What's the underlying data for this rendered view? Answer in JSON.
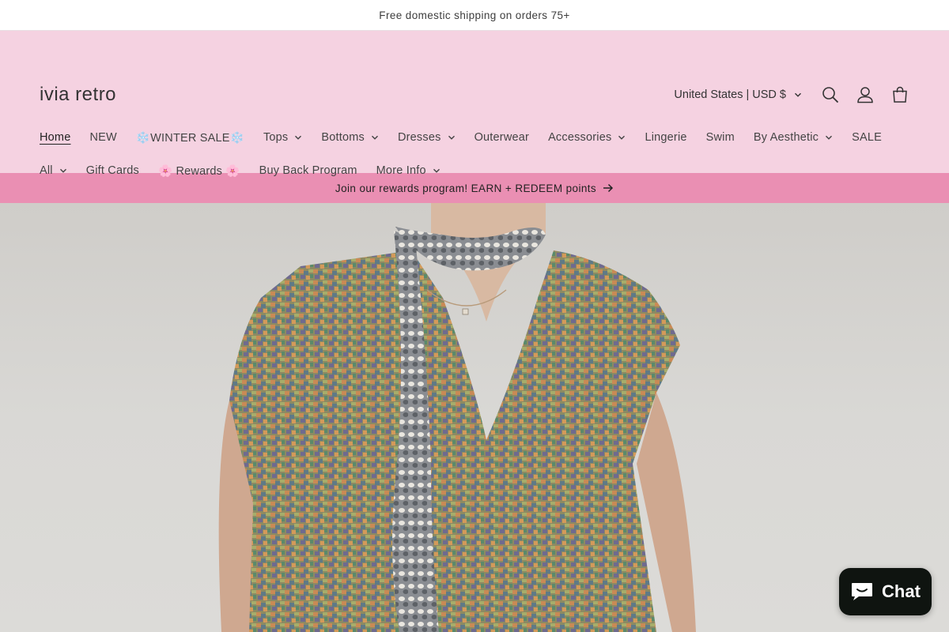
{
  "announcement": {
    "text": "Free domestic shipping on orders 75+"
  },
  "header": {
    "logo": "ivia retro",
    "currency": "United States | USD $",
    "icons": [
      "search-icon",
      "account-icon",
      "cart-icon"
    ]
  },
  "nav": {
    "row1": [
      {
        "label": "Home",
        "active": true,
        "dropdown": false
      },
      {
        "label": "NEW",
        "dropdown": false
      },
      {
        "label": "❄️WINTER SALE❄️",
        "dropdown": false
      },
      {
        "label": "Tops",
        "dropdown": true
      },
      {
        "label": "Bottoms",
        "dropdown": true
      },
      {
        "label": "Dresses",
        "dropdown": true
      },
      {
        "label": "Outerwear",
        "dropdown": false
      },
      {
        "label": "Accessories",
        "dropdown": true
      },
      {
        "label": "Lingerie",
        "dropdown": false
      },
      {
        "label": "Swim",
        "dropdown": false
      },
      {
        "label": "By Aesthetic",
        "dropdown": true
      },
      {
        "label": "SALE",
        "dropdown": false
      },
      {
        "label": "All",
        "dropdown": true
      }
    ],
    "row2": [
      {
        "label": "Gift Cards",
        "dropdown": false
      },
      {
        "label": "🌸 Rewards 🌸",
        "dropdown": false
      },
      {
        "label": "Buy Back Program",
        "dropdown": false
      },
      {
        "label": "More Info",
        "dropdown": true
      }
    ]
  },
  "rewards_bar": {
    "text": "Join our rewards program! EARN + REDEEM points"
  },
  "chat": {
    "label": "Chat"
  },
  "colors": {
    "header_bg": "#f5d2e1",
    "rewards_bg": "#ea8fb3",
    "chat_bg": "#0f1410"
  }
}
